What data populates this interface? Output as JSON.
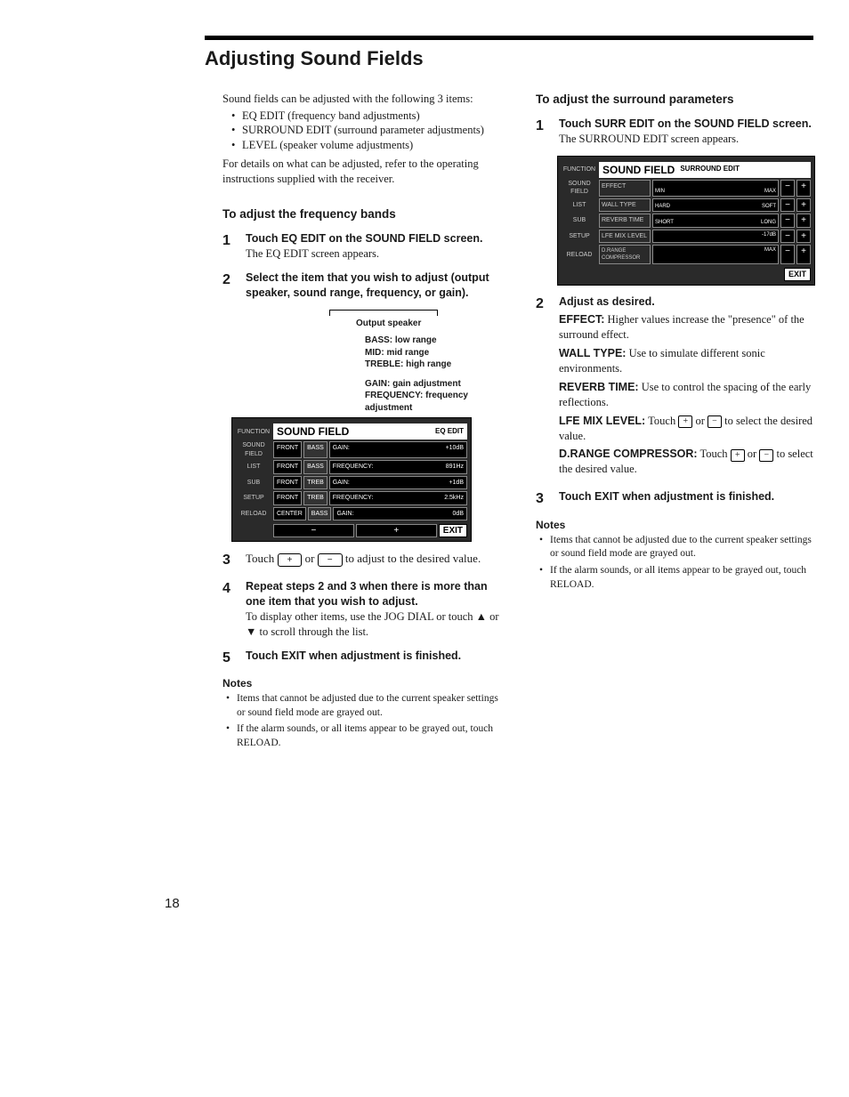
{
  "title": "Adjusting Sound Fields",
  "intro_line": "Sound fields can be adjusted with the following 3 items:",
  "intro_items": [
    "EQ EDIT (frequency band adjustments)",
    "SURROUND EDIT (surround parameter adjustments)",
    "LEVEL (speaker volume adjustments)"
  ],
  "intro_tail": "For details on what can be adjusted, refer to the operating instructions supplied with the receiver.",
  "left": {
    "subhead": "To adjust the frequency bands",
    "steps": {
      "1": {
        "b": "Touch EQ EDIT on the SOUND FIELD screen.",
        "r": "The EQ EDIT screen appears."
      },
      "2": {
        "b": "Select the item that you wish to adjust (output speaker, sound range, frequency, or gain)."
      },
      "3": {
        "pre": "Touch ",
        "btn1": "+",
        "mid": " or ",
        "btn2": "−",
        "post": " to adjust to the desired value."
      },
      "4": {
        "b": "Repeat steps 2 and 3 when there is more than one item that you wish to adjust.",
        "r": "To display other items, use the JOG DIAL or touch ▲ or ▼ to scroll through the list."
      },
      "5": {
        "b": "Touch EXIT when adjustment is finished."
      }
    },
    "legend": {
      "out": "Output speaker",
      "bass": "BASS: low range",
      "mid": "MID: mid range",
      "treble": "TREBLE: high range",
      "gain": "GAIN: gain adjustment",
      "freq": "FREQUENCY: frequency adjustment"
    },
    "eq": {
      "title": "SOUND FIELD",
      "sub": "EQ EDIT",
      "side": [
        "FUNCTION",
        "SOUND FIELD",
        "LIST",
        "SUB",
        "SETUP",
        "RELOAD"
      ],
      "rows": [
        {
          "sp": "FRONT",
          "rng": "BASS",
          "p": "GAIN:",
          "v": "+10dB"
        },
        {
          "sp": "FRONT",
          "rng": "BASS",
          "p": "FREQUENCY:",
          "v": "891Hz"
        },
        {
          "sp": "FRONT",
          "rng": "TREB",
          "p": "GAIN:",
          "v": "+1dB"
        },
        {
          "sp": "FRONT",
          "rng": "TREB",
          "p": "FREQUENCY:",
          "v": "2.5kHz"
        },
        {
          "sp": "CENTER",
          "rng": "BASS",
          "p": "GAIN:",
          "v": "0dB"
        }
      ],
      "minus": "−",
      "plus": "+",
      "exit": "EXIT"
    },
    "notes_h": "Notes",
    "notes": [
      "Items that cannot be adjusted due to the current speaker settings or sound field mode are grayed out.",
      "If the alarm sounds, or all items appear to be grayed out, touch RELOAD."
    ]
  },
  "right": {
    "subhead": "To adjust the surround parameters",
    "steps": {
      "1": {
        "b": "Touch SURR EDIT on the SOUND FIELD screen.",
        "r": "The SURROUND EDIT screen appears."
      },
      "2": {
        "b": "Adjust as desired."
      },
      "3": {
        "b": "Touch EXIT when adjustment is finished."
      }
    },
    "sur": {
      "title": "SOUND FIELD",
      "sub": "SURROUND EDIT",
      "side": [
        "FUNCTION",
        "SOUND FIELD",
        "LIST",
        "SUB",
        "SETUP",
        "RELOAD"
      ],
      "rows": [
        {
          "lab": "EFFECT",
          "l": "MIN",
          "r": "MAX"
        },
        {
          "lab": "WALL TYPE",
          "l": "HARD",
          "r": "SOFT"
        },
        {
          "lab": "REVERB TIME",
          "l": "SHORT",
          "r": "LONG"
        },
        {
          "lab": "LFE MIX LEVEL",
          "v": "-17dB"
        },
        {
          "lab": "D.RANGE COMPRESSOR",
          "v": "MAX"
        }
      ],
      "exit": "EXIT"
    },
    "params": [
      {
        "b": "EFFECT:",
        "t": " Higher values increase the \"presence\" of the surround effect."
      },
      {
        "b": "WALL TYPE:",
        "t": " Use to simulate different sonic environments."
      },
      {
        "b": "REVERB TIME:",
        "t": " Use to control the spacing of the early reflections."
      },
      {
        "b": "LFE MIX LEVEL:",
        "t_pre": " Touch ",
        "t_post": " to select the desired value."
      },
      {
        "b": "D.RANGE COMPRESSOR:",
        "t_pre": " Touch ",
        "t_post": " to select the desired value."
      }
    ],
    "notes_h": "Notes",
    "notes": [
      "Items that cannot be adjusted due to the current speaker settings or sound field mode are grayed out.",
      "If the alarm sounds, or all items appear to be grayed out, touch RELOAD."
    ]
  },
  "pagenum": "18",
  "sym": {
    "plus": "+",
    "minus": "−",
    "or": " or "
  }
}
